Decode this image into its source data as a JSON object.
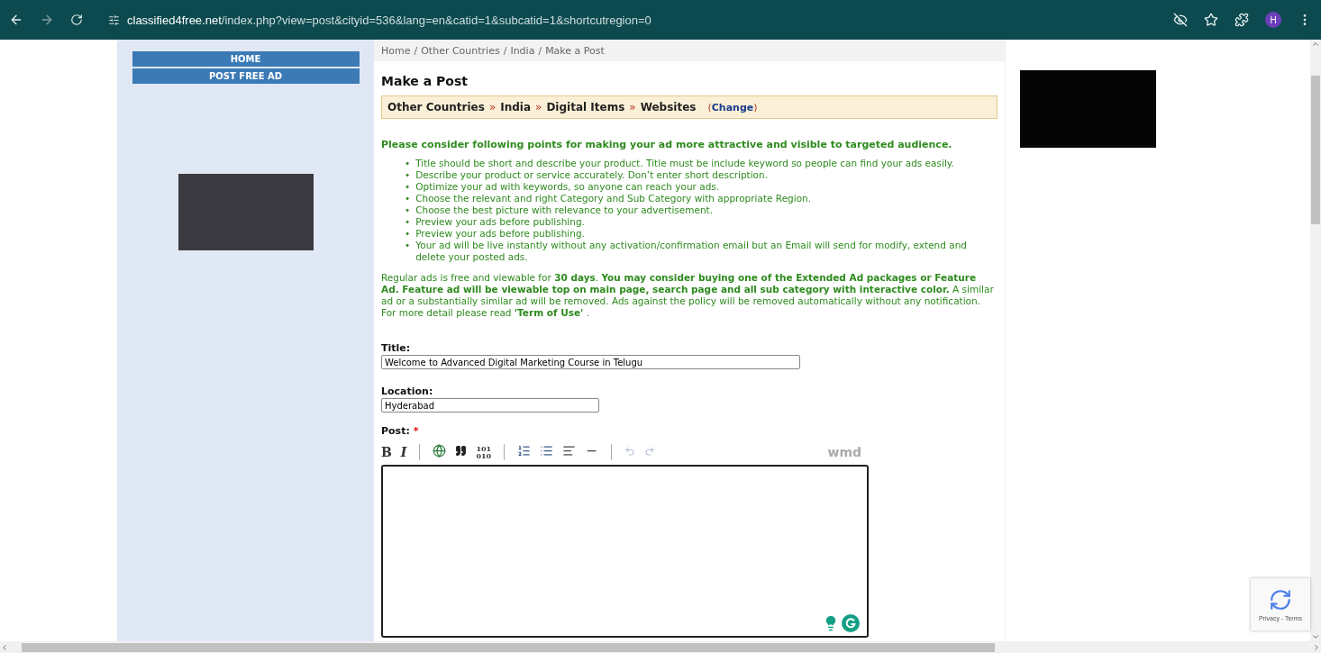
{
  "browser": {
    "url_domain": "classified4free.net",
    "url_path": "/index.php?view=post&cityid=536&lang=en&catid=1&subcatid=1&shortcutregion=0",
    "profile_initial": "H"
  },
  "sidebar": {
    "nav": [
      "HOME",
      "POST FREE AD"
    ]
  },
  "breadcrumb": {
    "separator": "/",
    "items": [
      "Home",
      "Other Countries",
      "India",
      "Make a Post"
    ]
  },
  "heading": "Make a Post",
  "category_path": {
    "separator": "»",
    "items": [
      "Other Countries",
      "India",
      "Digital Items",
      "Websites"
    ],
    "change_open": "(",
    "change_label": "Change",
    "change_close": ")"
  },
  "tips_heading": "Please consider following points for making your ad more attractive and visible to targeted audience.",
  "tip_marker": "•",
  "tips": [
    "Title should be short and describe your product. Title must be include keyword so people can find your ads easily.",
    "Describe your product or service accurately. Don’t enter short description.",
    "Optimize your ad with keywords, so anyone can reach your ads.",
    "Choose the relevant and right Category and Sub Category with appropriate Region.",
    "Choose the best picture with relevance to your advertisement.",
    "Preview your ads before publishing.",
    "Preview your ads before publishing.",
    "Your ad will be live instantly without any activation/confirmation email but an Email will send for modify, extend and delete your posted ads."
  ],
  "notice": "Regular ads is free and viewable for **30 days**. **You may consider buying one of the Extended Ad packages or Feature Ad. Feature ad will be viewable top on main page, search page and all sub category with interactive color.** A similar ad or a substantially similar ad will be removed. Ads against the policy will be removed automatically without any notification. For more detail please read **'Term of Use'** .",
  "fields": [
    {
      "label": "Title:",
      "value": "Welcome to Advanced Digital Marketing Course in Telugu"
    },
    {
      "label": "Location:",
      "value": "Hyderabad"
    }
  ],
  "post": {
    "label": "Post:",
    "required": true,
    "required_mark": "*"
  },
  "toolbar": [
    {
      "kind": "bold",
      "text": "B"
    },
    {
      "kind": "italic",
      "text": "I"
    },
    {
      "kind": "separator"
    },
    {
      "kind": "link"
    },
    {
      "kind": "quote"
    },
    {
      "kind": "code",
      "text": "101\n010"
    },
    {
      "kind": "separator"
    },
    {
      "kind": "ordered-list"
    },
    {
      "kind": "bulleted-list"
    },
    {
      "kind": "heading"
    },
    {
      "kind": "rule"
    },
    {
      "kind": "separator"
    },
    {
      "kind": "undo"
    },
    {
      "kind": "redo"
    }
  ],
  "editor_brand": "wmd",
  "recaptcha": {
    "links": "Privacy - Terms"
  }
}
